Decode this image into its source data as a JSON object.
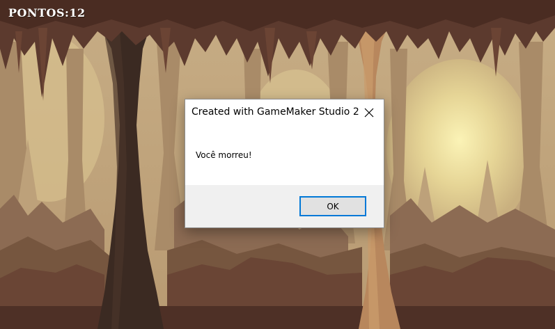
{
  "hud": {
    "score_text": "PONTOS:12"
  },
  "dialog": {
    "title": "Created with GameMaker Studio 2",
    "message": "Você morreu!",
    "ok_label": "OK",
    "close_icon": "close-icon"
  },
  "colors": {
    "button_focus_border": "#0078d7",
    "dialog_footer": "#f0f0f0",
    "cave_light": "#efe3a3",
    "cave_dark_rock": "#3b2a22"
  }
}
